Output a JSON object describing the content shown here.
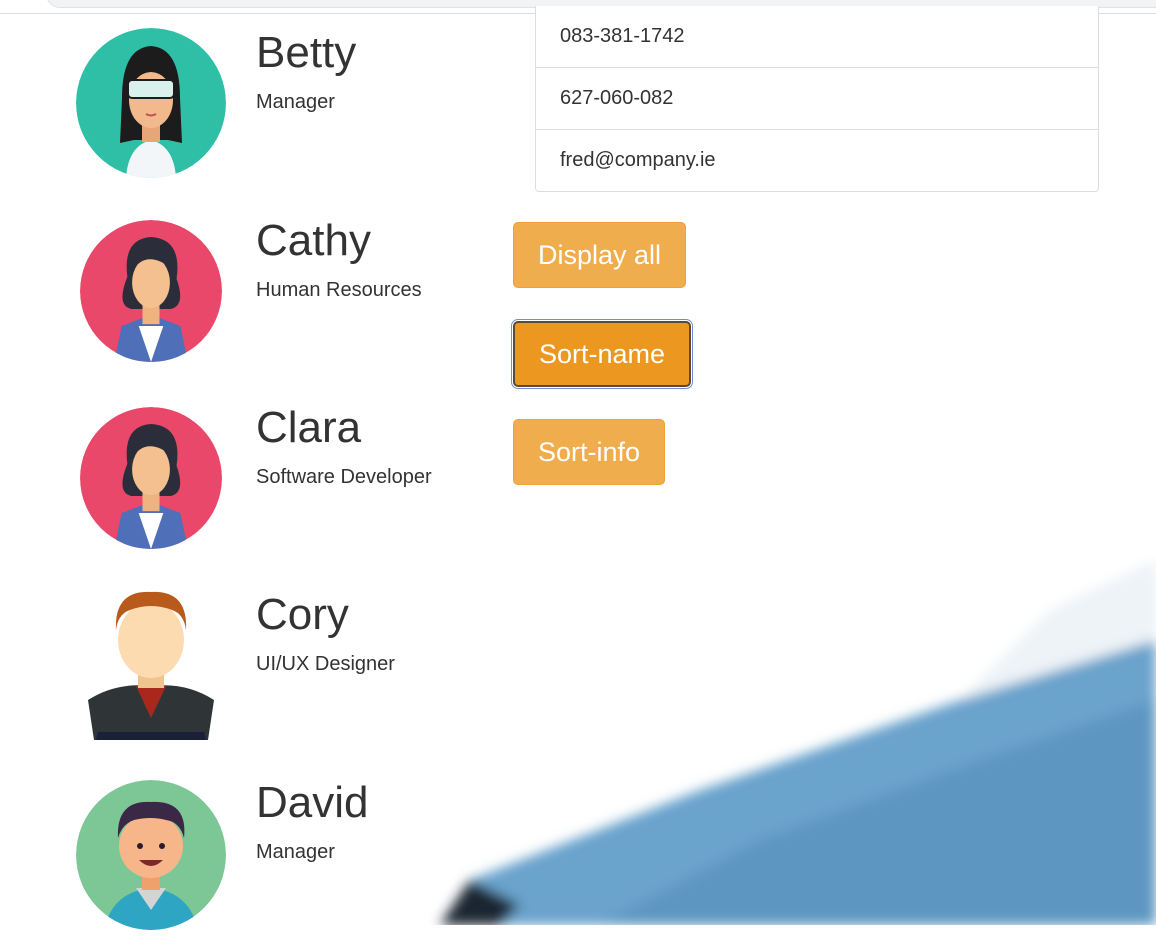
{
  "people": [
    {
      "name": "Betty",
      "role": "Manager",
      "avatar": "woman-glasses-avatar"
    },
    {
      "name": "Cathy",
      "role": "Human Resources",
      "avatar": "woman-avatar"
    },
    {
      "name": "Clara",
      "role": "Software Developer",
      "avatar": "woman-avatar"
    },
    {
      "name": "Cory",
      "role": "UI/UX Designer",
      "avatar": "man-jacket-avatar"
    },
    {
      "name": "David",
      "role": "Manager",
      "avatar": "boy-smiling-avatar"
    }
  ],
  "info": {
    "phone": "083-381-1742",
    "mobile": "627-060-082",
    "email": "fred@company.ie"
  },
  "buttons": {
    "display_all": "Display all",
    "sort_name": "Sort-name",
    "sort_info": "Sort-info"
  },
  "colors": {
    "button": "#f0ad4e",
    "button_active": "#ec971f",
    "avatar_teal": "#2fbfa6",
    "avatar_red": "#e9486b",
    "avatar_green": "#7cc795"
  }
}
